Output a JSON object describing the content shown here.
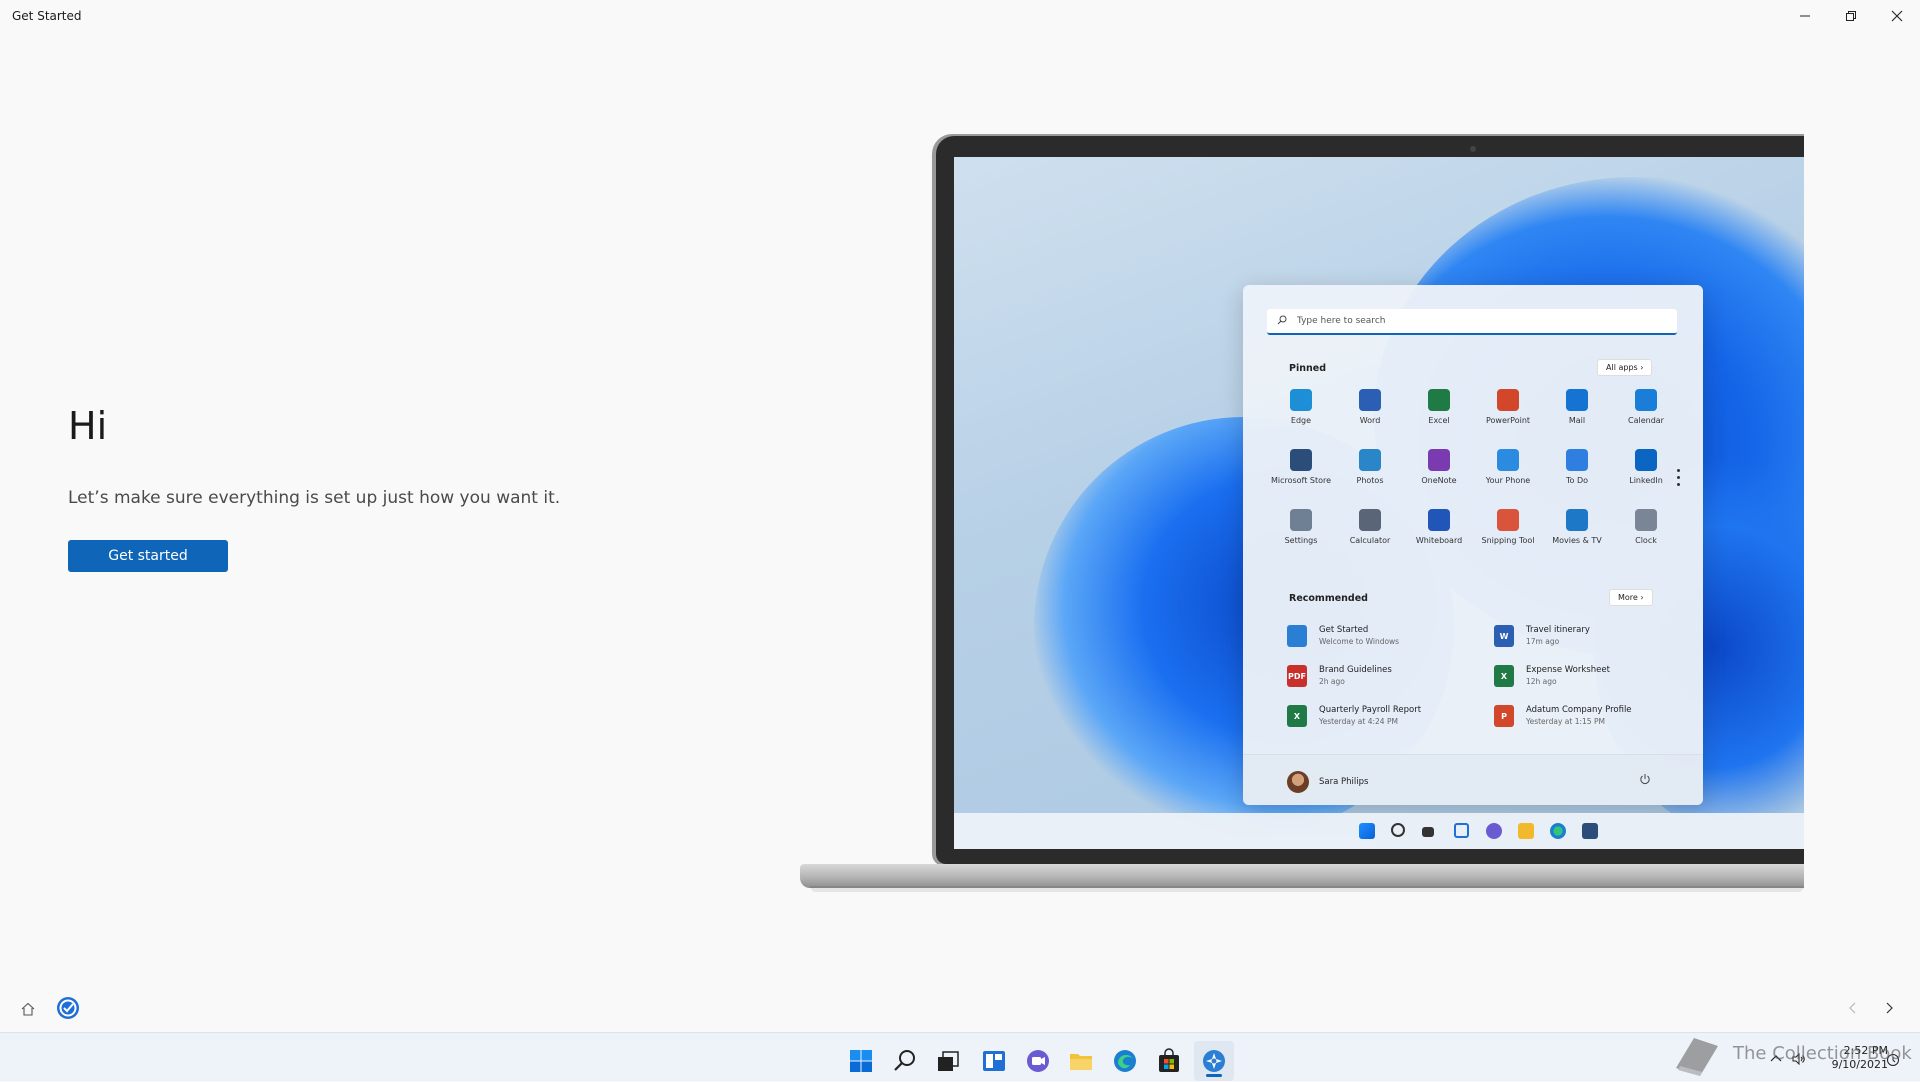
{
  "window": {
    "title": "Get Started",
    "controls": [
      "minimize",
      "restore",
      "close"
    ]
  },
  "welcome": {
    "heading": "Hi",
    "subtitle": "Let’s make sure everything is set up just how you want it.",
    "primary_button": "Get started"
  },
  "illustration": {
    "start_menu": {
      "search_placeholder": "Type here to search",
      "pinned_label": "Pinned",
      "all_apps_label": "All apps",
      "pinned_apps": [
        {
          "label": "Edge",
          "icon": "edge-icon",
          "color": "#1d8fd6"
        },
        {
          "label": "Word",
          "icon": "word-icon",
          "color": "#2b5fb3"
        },
        {
          "label": "Excel",
          "icon": "excel-icon",
          "color": "#1f7a45"
        },
        {
          "label": "PowerPoint",
          "icon": "powerpoint-icon",
          "color": "#d2472a"
        },
        {
          "label": "Mail",
          "icon": "mail-icon",
          "color": "#1573d1"
        },
        {
          "label": "Calendar",
          "icon": "calendar-icon",
          "color": "#1a7ed8"
        },
        {
          "label": "Microsoft Store",
          "icon": "store-icon",
          "color": "#2a4d7a"
        },
        {
          "label": "Photos",
          "icon": "photos-icon",
          "color": "#2a86c9"
        },
        {
          "label": "OneNote",
          "icon": "onenote-icon",
          "color": "#7b3bb0"
        },
        {
          "label": "Your Phone",
          "icon": "phone-icon",
          "color": "#2b8be0"
        },
        {
          "label": "To Do",
          "icon": "todo-icon",
          "color": "#2f7fe0"
        },
        {
          "label": "LinkedIn",
          "icon": "linkedin-icon",
          "color": "#0a66c2"
        },
        {
          "label": "Settings",
          "icon": "settings-icon",
          "color": "#6f7f94"
        },
        {
          "label": "Calculator",
          "icon": "calculator-icon",
          "color": "#5a6678"
        },
        {
          "label": "Whiteboard",
          "icon": "whiteboard-icon",
          "color": "#2155b8"
        },
        {
          "label": "Snipping Tool",
          "icon": "snipping-icon",
          "color": "#d9543b"
        },
        {
          "label": "Movies & TV",
          "icon": "movies-icon",
          "color": "#1e78c8"
        },
        {
          "label": "Clock",
          "icon": "clock-icon",
          "color": "#7a8596"
        }
      ],
      "recommended_label": "Recommended",
      "more_label": "More",
      "recommended": [
        {
          "title": "Get Started",
          "subtitle": "Welcome to Windows",
          "icon": "get-started-icon",
          "color": "#2a7fd4",
          "badge": ""
        },
        {
          "title": "Travel itinerary",
          "subtitle": "17m ago",
          "icon": "word-doc-icon",
          "color": "#2b5fb3",
          "badge": "W"
        },
        {
          "title": "Brand Guidelines",
          "subtitle": "2h ago",
          "icon": "pdf-icon",
          "color": "#c9302c",
          "badge": "PDF"
        },
        {
          "title": "Expense Worksheet",
          "subtitle": "12h ago",
          "icon": "excel-doc-icon",
          "color": "#1f7a45",
          "badge": "X"
        },
        {
          "title": "Quarterly Payroll Report",
          "subtitle": "Yesterday at 4:24 PM",
          "icon": "excel-doc-icon",
          "color": "#1f7a45",
          "badge": "X"
        },
        {
          "title": "Adatum Company Profile",
          "subtitle": "Yesterday at 1:15 PM",
          "icon": "powerpoint-doc-icon",
          "color": "#d2472a",
          "badge": "P"
        }
      ],
      "user_name": "Sara Philips"
    }
  },
  "taskbar": {
    "apps": [
      "start-icon",
      "search-icon",
      "task-view-icon",
      "widgets-icon",
      "chat-icon",
      "file-explorer-icon",
      "edge-icon",
      "store-icon",
      "get-started-icon"
    ],
    "time": "2:52 PM",
    "date": "9/10/2021"
  },
  "watermark": {
    "text": "The Collection Book"
  },
  "colors": {
    "accent": "#0f65b7",
    "background": "#f9f9f9",
    "taskbar": "#eef3f9"
  }
}
